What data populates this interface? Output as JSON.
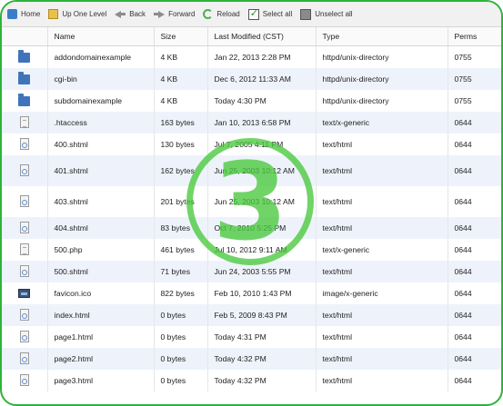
{
  "toolbar": {
    "home": "Home",
    "up": "Up One Level",
    "back": "Back",
    "forward": "Forward",
    "reload": "Reload",
    "select_all": "Select all",
    "unselect_all": "Unselect all"
  },
  "columns": {
    "name": "Name",
    "size": "Size",
    "modified": "Last Modified (CST)",
    "type": "Type",
    "perms": "Perms"
  },
  "files": [
    {
      "icon": "folder-icon",
      "name": "addondomainexample",
      "size": "4 KB",
      "modified": "Jan 22, 2013 2:28 PM",
      "type": "httpd/unix-directory",
      "perms": "0755"
    },
    {
      "icon": "folder-icon",
      "name": "cgi-bin",
      "size": "4 KB",
      "modified": "Dec 6, 2012 11:33 AM",
      "type": "httpd/unix-directory",
      "perms": "0755"
    },
    {
      "icon": "folder-icon",
      "name": "subdomainexample",
      "size": "4 KB",
      "modified": "Today 4:30 PM",
      "type": "httpd/unix-directory",
      "perms": "0755"
    },
    {
      "icon": "generic-file-icon",
      "name": ".htaccess",
      "size": "163 bytes",
      "modified": "Jan 10, 2013 6:58 PM",
      "type": "text/x-generic",
      "perms": "0644"
    },
    {
      "icon": "html-file-icon",
      "name": "400.shtml",
      "size": "130 bytes",
      "modified": "Jul 7, 2005 4:11 PM",
      "type": "text/html",
      "perms": "0644"
    },
    {
      "icon": "html-file-icon",
      "name": "401.shtml",
      "size": "162 bytes",
      "modified": "Jun 25, 2003 10:12 AM",
      "type": "text/html",
      "perms": "0644"
    },
    {
      "icon": "html-file-icon",
      "name": "403.shtml",
      "size": "201 bytes",
      "modified": "Jun 25, 2003 10:12 AM",
      "type": "text/html",
      "perms": "0644"
    },
    {
      "icon": "html-file-icon",
      "name": "404.shtml",
      "size": "83 bytes",
      "modified": "Oct 7, 2010 5:25 PM",
      "type": "text/html",
      "perms": "0644"
    },
    {
      "icon": "generic-file-icon",
      "name": "500.php",
      "size": "461 bytes",
      "modified": "Jul 10, 2012 9:11 AM",
      "type": "text/x-generic",
      "perms": "0644"
    },
    {
      "icon": "html-file-icon",
      "name": "500.shtml",
      "size": "71 bytes",
      "modified": "Jun 24, 2003 5:55 PM",
      "type": "text/html",
      "perms": "0644"
    },
    {
      "icon": "image-file-icon",
      "name": "favicon.ico",
      "size": "822 bytes",
      "modified": "Feb 10, 2010 1:43 PM",
      "type": "image/x-generic",
      "perms": "0644"
    },
    {
      "icon": "html-file-icon",
      "name": "index.html",
      "size": "0 bytes",
      "modified": "Feb 5, 2009 8:43 PM",
      "type": "text/html",
      "perms": "0644"
    },
    {
      "icon": "html-file-icon",
      "name": "page1.html",
      "size": "0 bytes",
      "modified": "Today 4:31 PM",
      "type": "text/html",
      "perms": "0644"
    },
    {
      "icon": "html-file-icon",
      "name": "page2.html",
      "size": "0 bytes",
      "modified": "Today 4:32 PM",
      "type": "text/html",
      "perms": "0644"
    },
    {
      "icon": "html-file-icon",
      "name": "page3.html",
      "size": "0 bytes",
      "modified": "Today 4:32 PM",
      "type": "text/html",
      "perms": "0644"
    }
  ],
  "overlay": {
    "step_number": "3"
  },
  "colors": {
    "accent_green": "#2db43a",
    "row_stripe": "#eef3fb",
    "folder_blue": "#3f74bb"
  }
}
